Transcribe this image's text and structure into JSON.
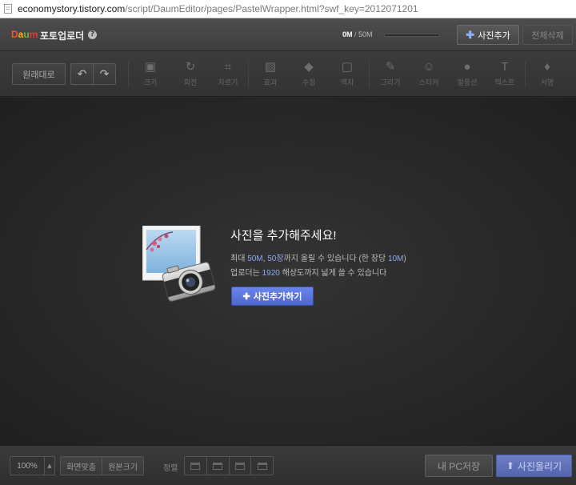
{
  "browser": {
    "url_host": "economystory.tistory.com",
    "url_path": "/script/DaumEditor/pages/PastelWrapper.html?swf_key=2012071201"
  },
  "header": {
    "logo": [
      "D",
      "a",
      "u",
      "m"
    ],
    "title": "포토업로더",
    "help": "?",
    "usage_current": "0M",
    "usage_sep": " / ",
    "usage_max": "50M",
    "usage_fraction": 0.0,
    "add_photo_label": "사진추가",
    "delete_all_label": "전체삭제"
  },
  "toolbar": {
    "original_label": "원래대로",
    "undo_icon": "↶",
    "redo_icon": "↷",
    "tools": [
      {
        "icon": "▣",
        "label": "크기"
      },
      {
        "icon": "↻",
        "label": "회전"
      },
      {
        "icon": "⌗",
        "label": "자르기"
      },
      {
        "icon": "▧",
        "label": "효과"
      },
      {
        "icon": "◆",
        "label": "수정"
      },
      {
        "icon": "▢",
        "label": "액자"
      },
      {
        "icon": "✎",
        "label": "그리기"
      },
      {
        "icon": "☺",
        "label": "스티커"
      },
      {
        "icon": "●",
        "label": "말풍선"
      },
      {
        "icon": "T",
        "label": "텍스트"
      },
      {
        "icon": "♦",
        "label": "서명"
      }
    ]
  },
  "empty_state": {
    "title": "사진을 추가해주세요!",
    "line1_a": "최대 ",
    "line1_size": "50M",
    "line1_b": ", ",
    "line1_count": "50장",
    "line1_c": "까지 올릴 수 있습니다 (한 장당 ",
    "line1_per": "10M",
    "line1_d": ")",
    "line2_a": "업로더는 ",
    "line2_res": "1920",
    "line2_b": " 해상도까지 넓게 쓸 수 있습니다",
    "button_label": "사진추가하기"
  },
  "footer": {
    "zoom_value": "100%",
    "zoom_arrow": "▲",
    "fit_label": "화면맞춤",
    "original_size_label": "원본크기",
    "align_label": "정렬",
    "save_pc_label": "내 PC저장",
    "upload_label": "사진올리기"
  },
  "colors": {
    "accent": "#5a72d8",
    "highlight_text": "#8ea7f5"
  }
}
